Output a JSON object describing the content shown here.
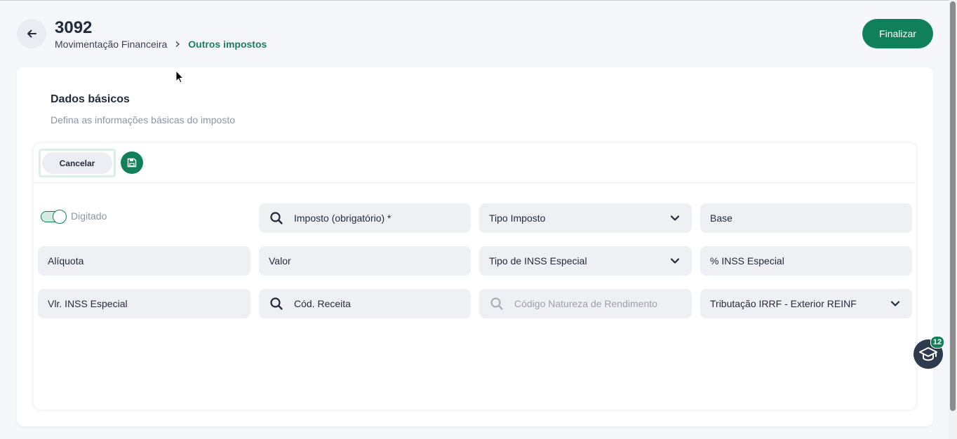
{
  "header": {
    "title": "3092",
    "breadcrumb": [
      "Movimentação Financeira",
      "Outros impostos"
    ],
    "finalizar_label": "Finalizar"
  },
  "section": {
    "title": "Dados básicos",
    "subtitle": "Defina as informações básicas do imposto"
  },
  "toolbar": {
    "cancel_label": "Cancelar",
    "save_icon": "save-icon"
  },
  "toggle": {
    "label": "Digitado",
    "on": true
  },
  "fields": {
    "imposto": "Imposto (obrigatório) *",
    "tipo_imposto": "Tipo Imposto",
    "base": "Base",
    "aliquota": "Alíquota",
    "valor": "Valor",
    "tipo_inss_especial": "Tipo de INSS Especial",
    "perc_inss_especial": "% INSS Especial",
    "vlr_inss_especial": "Vlr. INSS Especial",
    "cod_receita": "Cód. Receita",
    "codigo_natureza": "Código Natureza de Rendimento",
    "tributacao_irrf": "Tributação IRRF - Exterior REINF"
  },
  "help": {
    "badge": "12",
    "icon": "graduation-cap-icon"
  },
  "colors": {
    "accent": "#10805a",
    "field_bg": "#eef0f4",
    "text": "#1f2a3c",
    "muted": "#8d95a3"
  }
}
